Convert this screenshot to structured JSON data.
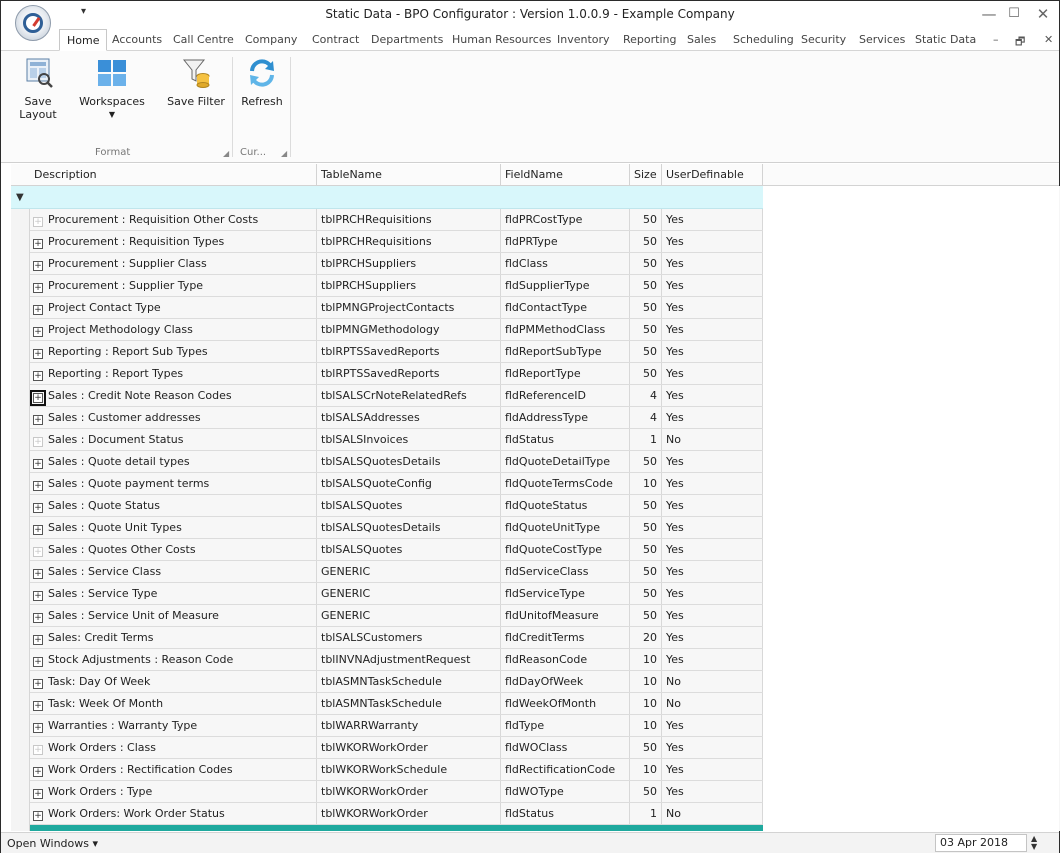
{
  "window": {
    "title": "Static Data - BPO Configurator : Version 1.0.0.9 - Example Company",
    "qat_arrow": "▾",
    "minimize": "—",
    "maximize": "☐",
    "close": "✕"
  },
  "ribbon_tabs": [
    "Home",
    "Accounts",
    "Call Centre",
    "Company",
    "Contract",
    "Departments",
    "Human Resources",
    "Inventory",
    "Reporting",
    "Sales",
    "Scheduling",
    "Security",
    "Services",
    "Static Data"
  ],
  "mdi_controls": {
    "minimize": "–",
    "restore": "🗗",
    "close": "✕"
  },
  "ribbon": {
    "save_layout": "Save Layout",
    "workspaces": "Workspaces",
    "save_filter": "Save Filter",
    "refresh": "Refresh",
    "format_group": "Format",
    "current_group": "Cur..."
  },
  "grid": {
    "columns": [
      "Description",
      "TableName",
      "FieldName",
      "Size",
      "UserDefinable"
    ],
    "filter_icon": "▼",
    "rows": [
      {
        "desc": "Procurement : Requisition Other Costs",
        "table": "tblPRCHRequisitions",
        "field": "fldPRCostType",
        "size": "50",
        "user": "Yes",
        "expander": "dim"
      },
      {
        "desc": "Procurement : Requisition Types",
        "table": "tblPRCHRequisitions",
        "field": "fldPRType",
        "size": "50",
        "user": "Yes",
        "expander": "normal"
      },
      {
        "desc": "Procurement : Supplier Class",
        "table": "tblPRCHSuppliers",
        "field": "fldClass",
        "size": "50",
        "user": "Yes",
        "expander": "normal"
      },
      {
        "desc": "Procurement : Supplier Type",
        "table": "tblPRCHSuppliers",
        "field": "fldSupplierType",
        "size": "50",
        "user": "Yes",
        "expander": "normal"
      },
      {
        "desc": "Project Contact Type",
        "table": "tblPMNGProjectContacts",
        "field": "fldContactType",
        "size": "50",
        "user": "Yes",
        "expander": "normal"
      },
      {
        "desc": "Project Methodology Class",
        "table": "tblPMNGMethodology",
        "field": "fldPMMethodClass",
        "size": "50",
        "user": "Yes",
        "expander": "normal"
      },
      {
        "desc": "Reporting : Report Sub Types",
        "table": "tblRPTSSavedReports",
        "field": "fldReportSubType",
        "size": "50",
        "user": "Yes",
        "expander": "normal"
      },
      {
        "desc": "Reporting : Report Types",
        "table": "tblRPTSSavedReports",
        "field": "fldReportType",
        "size": "50",
        "user": "Yes",
        "expander": "normal"
      },
      {
        "desc": "Sales : Credit Note Reason Codes",
        "table": "tblSALSCrNoteRelatedRefs",
        "field": "fldReferenceID",
        "size": "4",
        "user": "Yes",
        "expander": "focus"
      },
      {
        "desc": "Sales : Customer addresses",
        "table": "tblSALSAddresses",
        "field": "fldAddressType",
        "size": "4",
        "user": "Yes",
        "expander": "normal"
      },
      {
        "desc": "Sales : Document Status",
        "table": "tblSALSInvoices",
        "field": "fldStatus",
        "size": "1",
        "user": "No",
        "expander": "dim"
      },
      {
        "desc": "Sales : Quote detail types",
        "table": "tblSALSQuotesDetails",
        "field": "fldQuoteDetailType",
        "size": "50",
        "user": "Yes",
        "expander": "normal"
      },
      {
        "desc": "Sales : Quote payment terms",
        "table": "tblSALSQuoteConfig",
        "field": "fldQuoteTermsCode",
        "size": "10",
        "user": "Yes",
        "expander": "normal"
      },
      {
        "desc": "Sales : Quote Status",
        "table": "tblSALSQuotes",
        "field": "fldQuoteStatus",
        "size": "50",
        "user": "Yes",
        "expander": "normal"
      },
      {
        "desc": "Sales : Quote Unit Types",
        "table": "tblSALSQuotesDetails",
        "field": "fldQuoteUnitType",
        "size": "50",
        "user": "Yes",
        "expander": "normal"
      },
      {
        "desc": "Sales : Quotes Other Costs",
        "table": "tblSALSQuotes",
        "field": "fldQuoteCostType",
        "size": "50",
        "user": "Yes",
        "expander": "dim"
      },
      {
        "desc": "Sales : Service Class",
        "table": "GENERIC",
        "field": "fldServiceClass",
        "size": "50",
        "user": "Yes",
        "expander": "normal"
      },
      {
        "desc": "Sales : Service Type",
        "table": "GENERIC",
        "field": "fldServiceType",
        "size": "50",
        "user": "Yes",
        "expander": "normal"
      },
      {
        "desc": "Sales : Service Unit of Measure",
        "table": "GENERIC",
        "field": "fldUnitofMeasure",
        "size": "50",
        "user": "Yes",
        "expander": "normal"
      },
      {
        "desc": "Sales: Credit Terms",
        "table": "tblSALSCustomers",
        "field": "fldCreditTerms",
        "size": "20",
        "user": "Yes",
        "expander": "normal"
      },
      {
        "desc": "Stock Adjustments : Reason Code",
        "table": "tblINVNAdjustmentRequest",
        "field": "fldReasonCode",
        "size": "10",
        "user": "Yes",
        "expander": "normal"
      },
      {
        "desc": "Task: Day Of Week",
        "table": "tblASMNTaskSchedule",
        "field": "fldDayOfWeek",
        "size": "10",
        "user": "No",
        "expander": "normal"
      },
      {
        "desc": "Task: Week Of Month",
        "table": "tblASMNTaskSchedule",
        "field": "fldWeekOfMonth",
        "size": "10",
        "user": "No",
        "expander": "normal"
      },
      {
        "desc": "Warranties : Warranty Type",
        "table": "tblWARRWarranty",
        "field": "fldType",
        "size": "10",
        "user": "Yes",
        "expander": "normal"
      },
      {
        "desc": "Work Orders : Class",
        "table": "tblWKORWorkOrder",
        "field": "fldWOClass",
        "size": "50",
        "user": "Yes",
        "expander": "dim"
      },
      {
        "desc": "Work Orders : Rectification Codes",
        "table": "tblWKORWorkSchedule",
        "field": "fldRectificationCode",
        "size": "10",
        "user": "Yes",
        "expander": "normal"
      },
      {
        "desc": "Work Orders : Type",
        "table": "tblWKORWorkOrder",
        "field": "fldWOType",
        "size": "50",
        "user": "Yes",
        "expander": "normal"
      },
      {
        "desc": "Work Orders: Work Order Status",
        "table": "tblWKORWorkOrder",
        "field": "fldStatus",
        "size": "1",
        "user": "No",
        "expander": "normal"
      }
    ]
  },
  "status": {
    "open_windows": "Open Windows ▾",
    "date": "03 Apr 2018",
    "spin": "▲▼"
  },
  "colors": {
    "filter_row": "#d8f7fb",
    "footer_bar": "#1fa99e",
    "row_bg": "#f7f7f7"
  }
}
